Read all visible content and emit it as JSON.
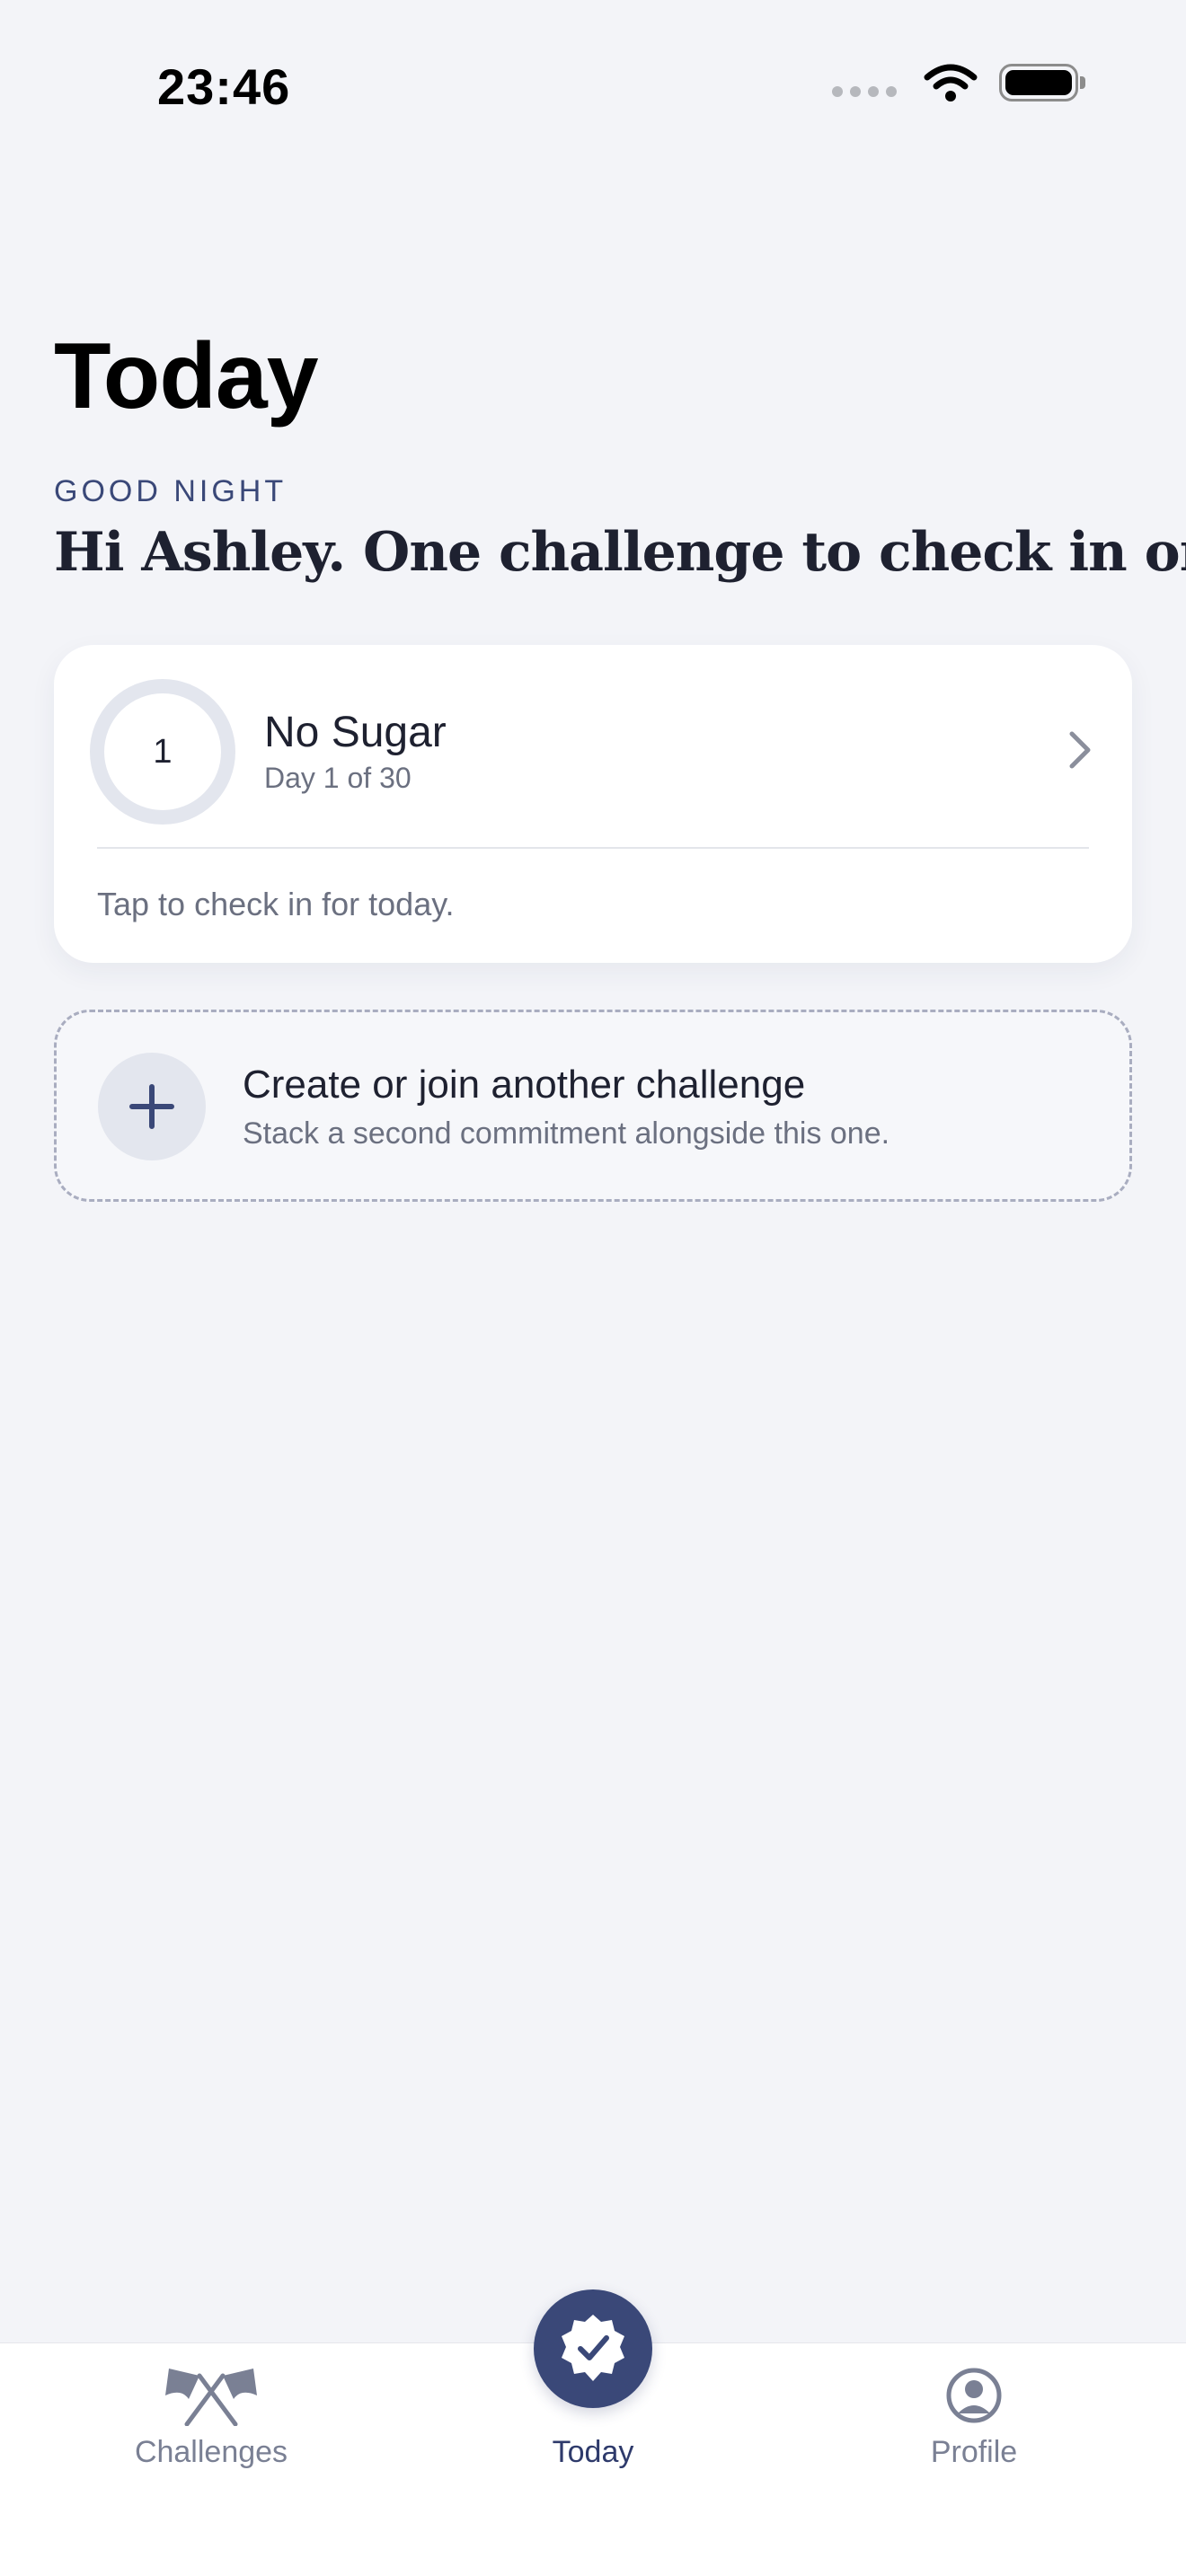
{
  "status_bar": {
    "time": "23:46"
  },
  "header": {
    "title": "Today",
    "eyebrow": "GOOD NIGHT",
    "greeting": "Hi Ashley. One challenge to check in on."
  },
  "challenge_card": {
    "ring_value": "1",
    "name": "No Sugar",
    "progress_text": "Day 1 of 30",
    "hint": "Tap to check in for today."
  },
  "add_challenge": {
    "title": "Create or join another challenge",
    "subtitle": "Stack a second commitment alongside this one."
  },
  "tab_bar": {
    "tabs": [
      {
        "label": "Challenges",
        "icon": "crossed-flags-icon"
      },
      {
        "label": "Today",
        "icon": "badge-check-icon",
        "active": true
      },
      {
        "label": "Profile",
        "icon": "person-circle-icon"
      }
    ]
  },
  "colors": {
    "background": "#f3f4f8",
    "accent": "#3a4878",
    "muted_text": "#6b7080",
    "card": "#ffffff"
  }
}
